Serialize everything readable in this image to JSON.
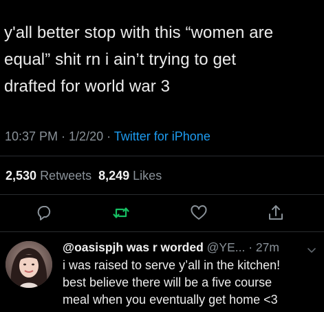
{
  "tweet": {
    "text": "y'all better stop with this “women are\nequal” shit rn i ain’t trying to get\ndrafted for world war 3",
    "time": "10:37 PM",
    "sep1": " · ",
    "date": "1/2/20",
    "sep2": " · ",
    "source": "Twitter for iPhone"
  },
  "stats": {
    "retweets_count": "2,530",
    "retweets_label": "Retweets",
    "likes_count": "8,249",
    "likes_label": "Likes"
  },
  "actions": [
    {
      "icon": "reply-icon",
      "color": "#8a9299"
    },
    {
      "icon": "retweet-icon",
      "color": "#17bf63"
    },
    {
      "icon": "heart-icon",
      "color": "#8a9299"
    },
    {
      "icon": "share-icon",
      "color": "#8a9299"
    }
  ],
  "reply": {
    "display_name": "@oasispjh was r worded",
    "handle": "@YE...",
    "sep": " · ",
    "time": "27m",
    "text": "i was raised to serve y’all in the kitchen!\nbest believe there will be a five course\nmeal when you eventually get home <3"
  },
  "colors": {
    "background": "#000000",
    "text": "#ececec",
    "muted": "#8a9299",
    "link": "#1d9bf0",
    "retweet_active": "#17bf63"
  }
}
